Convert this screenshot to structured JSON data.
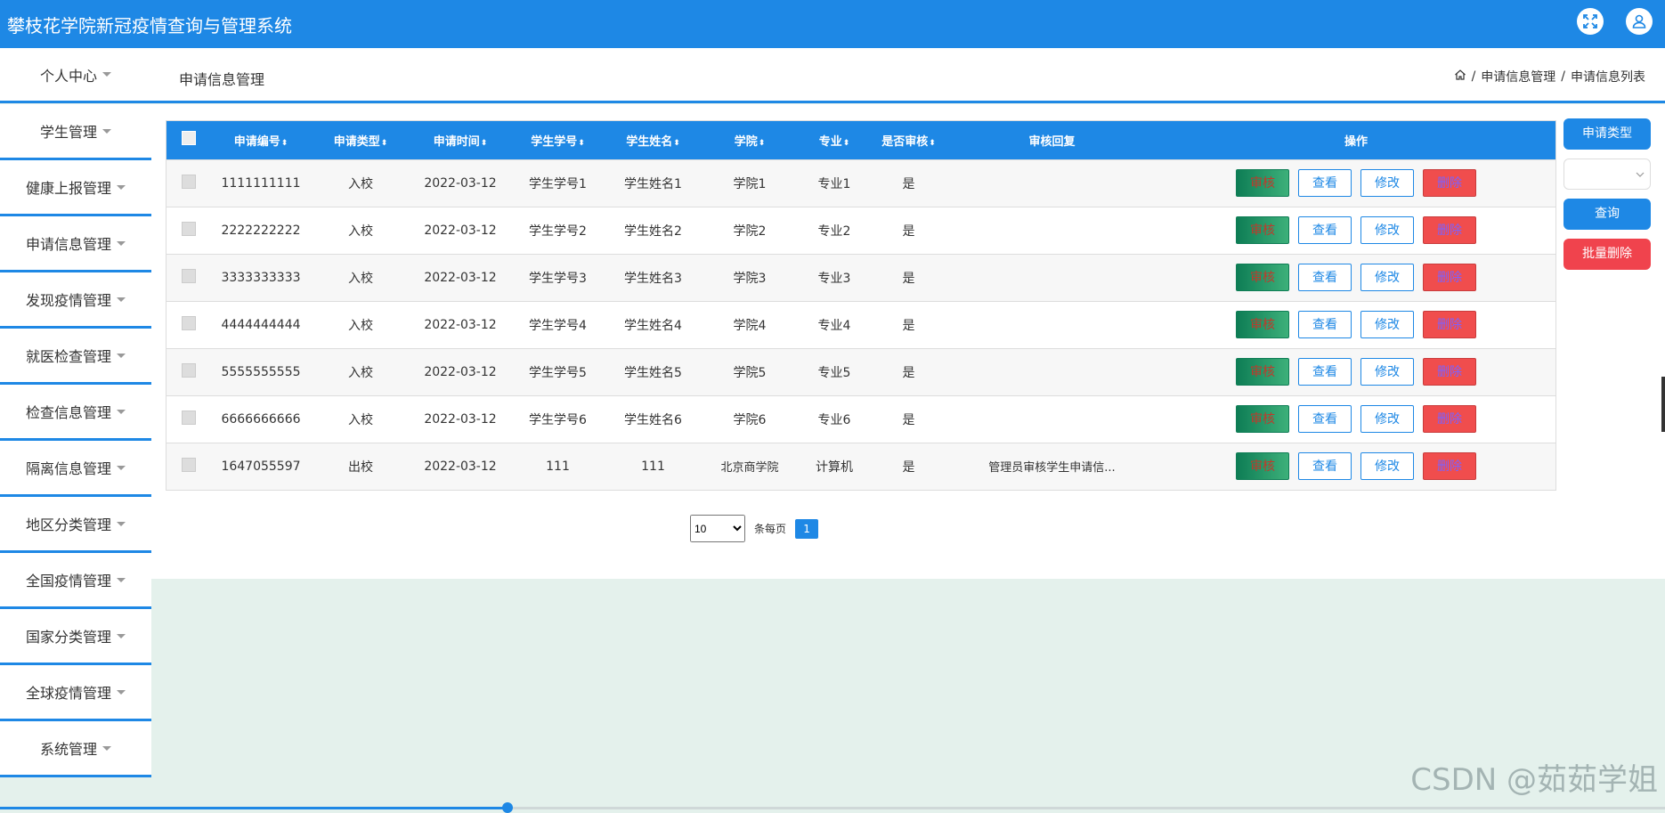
{
  "app": {
    "title": "攀枝花学院新冠疫情查询与管理系统"
  },
  "header": {
    "personal_center": "个人中心",
    "page_title": "申请信息管理",
    "breadcrumb": [
      "申请信息管理",
      "申请信息列表"
    ],
    "icons": [
      "fullscreen-icon",
      "user-icon",
      "home-icon"
    ]
  },
  "sidebar": {
    "items": [
      {
        "label": "学生管理"
      },
      {
        "label": "健康上报管理"
      },
      {
        "label": "申请信息管理"
      },
      {
        "label": "发现疫情管理"
      },
      {
        "label": "就医检查管理"
      },
      {
        "label": "检查信息管理"
      },
      {
        "label": "隔离信息管理"
      },
      {
        "label": "地区分类管理"
      },
      {
        "label": "全国疫情管理"
      },
      {
        "label": "国家分类管理"
      },
      {
        "label": "全球疫情管理"
      },
      {
        "label": "系统管理"
      }
    ]
  },
  "table": {
    "columns": [
      "申请编号",
      "申请类型",
      "申请时间",
      "学生学号",
      "学生姓名",
      "学院",
      "专业",
      "是否审核",
      "审核回复",
      "操作"
    ],
    "sortable": [
      true,
      true,
      true,
      true,
      true,
      true,
      true,
      true,
      false,
      false
    ],
    "rows": [
      {
        "id": "1111111111",
        "type": "入校",
        "time": "2022-03-12",
        "sno": "学生学号1",
        "sname": "学生姓名1",
        "college": "学院1",
        "major": "专业1",
        "audited": "是",
        "reply": ""
      },
      {
        "id": "2222222222",
        "type": "入校",
        "time": "2022-03-12",
        "sno": "学生学号2",
        "sname": "学生姓名2",
        "college": "学院2",
        "major": "专业2",
        "audited": "是",
        "reply": ""
      },
      {
        "id": "3333333333",
        "type": "入校",
        "time": "2022-03-12",
        "sno": "学生学号3",
        "sname": "学生姓名3",
        "college": "学院3",
        "major": "专业3",
        "audited": "是",
        "reply": ""
      },
      {
        "id": "4444444444",
        "type": "入校",
        "time": "2022-03-12",
        "sno": "学生学号4",
        "sname": "学生姓名4",
        "college": "学院4",
        "major": "专业4",
        "audited": "是",
        "reply": ""
      },
      {
        "id": "5555555555",
        "type": "入校",
        "time": "2022-03-12",
        "sno": "学生学号5",
        "sname": "学生姓名5",
        "college": "学院5",
        "major": "专业5",
        "audited": "是",
        "reply": ""
      },
      {
        "id": "6666666666",
        "type": "入校",
        "time": "2022-03-12",
        "sno": "学生学号6",
        "sname": "学生姓名6",
        "college": "学院6",
        "major": "专业6",
        "audited": "是",
        "reply": ""
      },
      {
        "id": "1647055597",
        "type": "出校",
        "time": "2022-03-12",
        "sno": "111",
        "sname": "111",
        "college": "北京商学院",
        "major": "计算机",
        "audited": "是",
        "reply": "管理员审核学生申请信..."
      }
    ],
    "actions": {
      "audit": "审核",
      "view": "查看",
      "edit": "修改",
      "delete": "删除"
    }
  },
  "pagination": {
    "page_size": "10",
    "page_size_options": [
      "10"
    ],
    "per_page_label": "条每页",
    "current_page": "1"
  },
  "right_panel": {
    "type_button": "申请类型",
    "select_value": "",
    "query_button": "查询",
    "batch_delete_button": "批量删除"
  },
  "watermark": "CSDN @茹茹学姐",
  "colors": {
    "primary": "#1e88e5",
    "danger": "#f04d4d",
    "success": "#0e7d55",
    "background": "#e4f1ec"
  },
  "bottom_progress": 0.305
}
